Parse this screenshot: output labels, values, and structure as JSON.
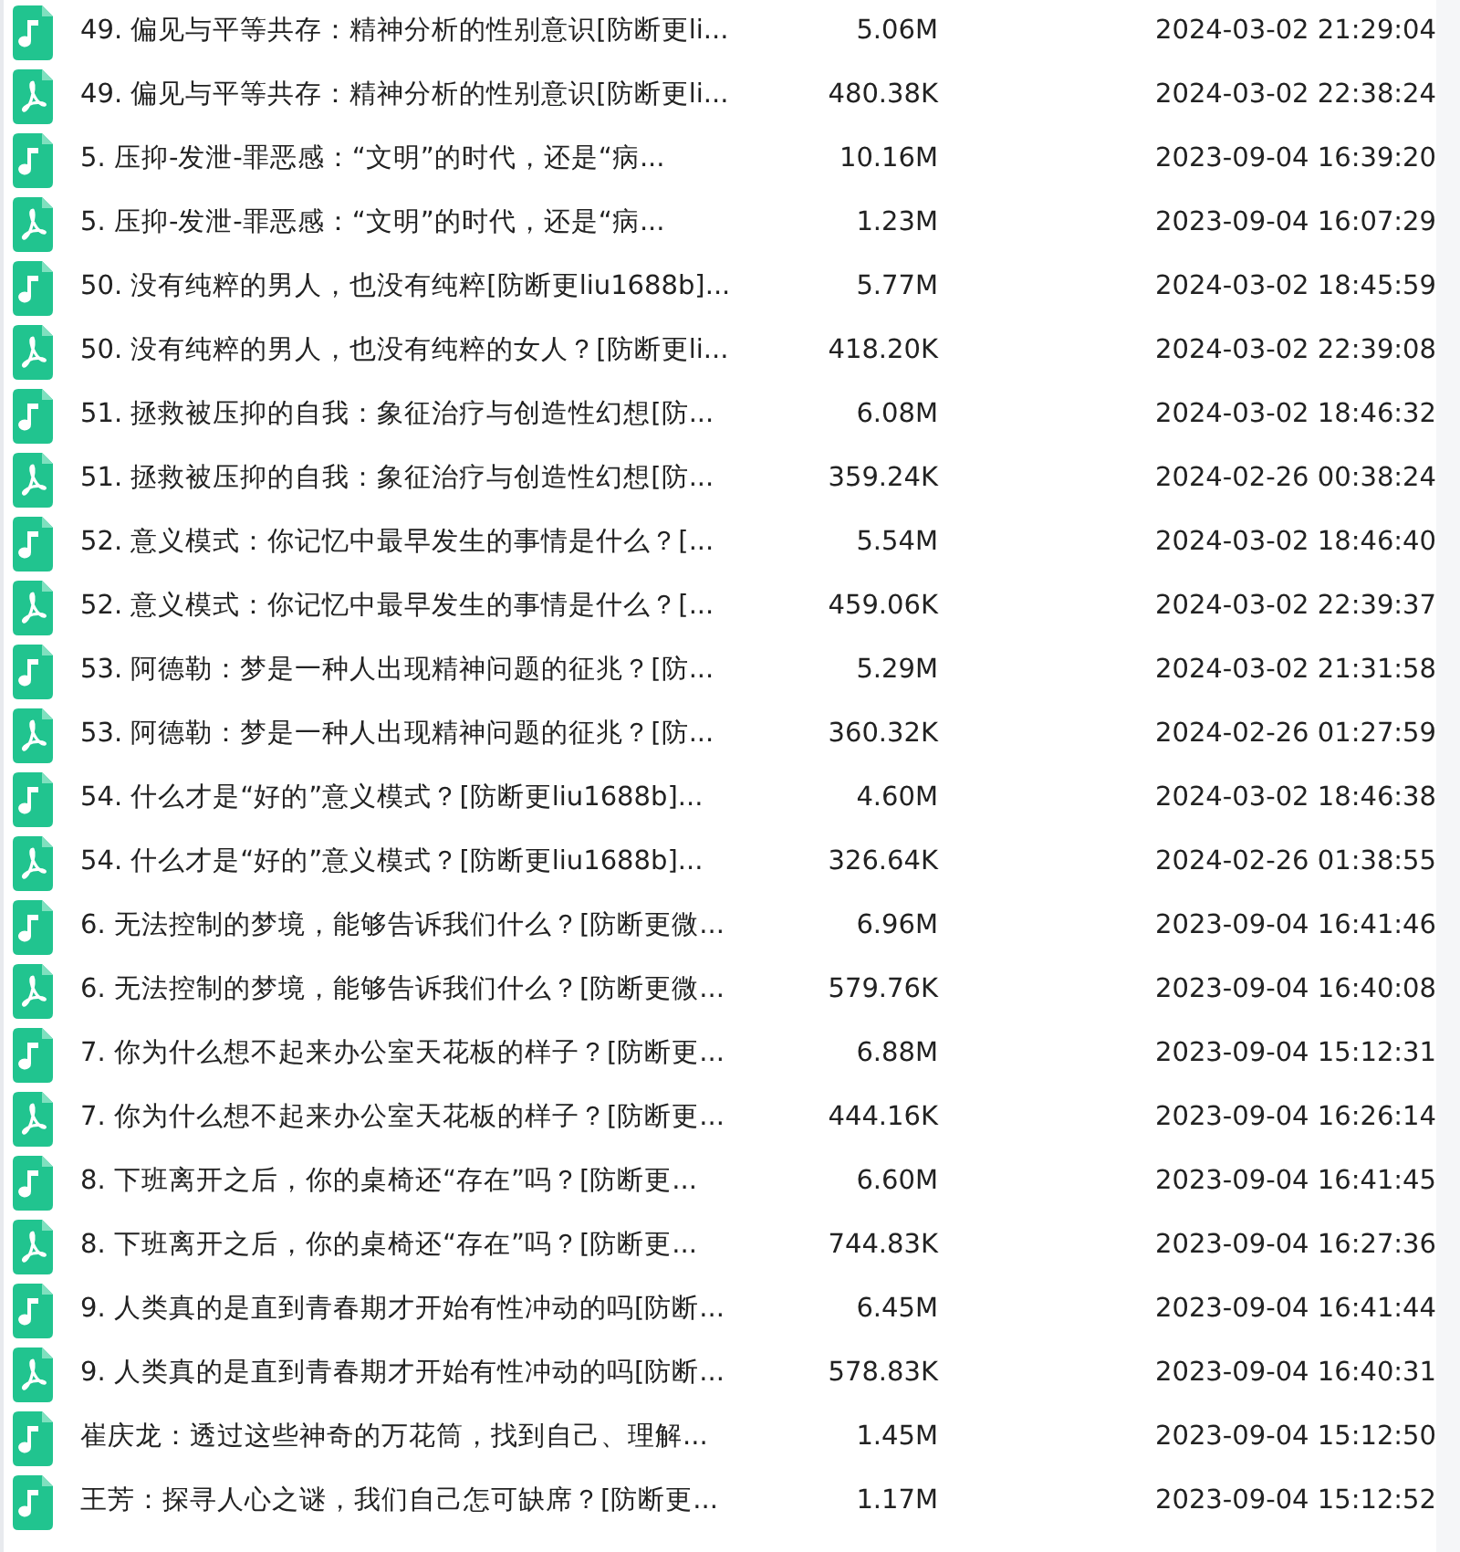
{
  "files": [
    {
      "kind": "audio",
      "name": "49. 偏见与平等共存：精神分析的性别意识[防断更li...",
      "size": "5.06M",
      "modified": "2024-03-02 21:29:04"
    },
    {
      "kind": "pdf",
      "name": "49. 偏见与平等共存：精神分析的性别意识[防断更li...",
      "size": "480.38K",
      "modified": "2024-03-02 22:38:24"
    },
    {
      "kind": "audio",
      "name": "5. 压抑-发泄-罪恶感：“文明”的时代，还是“病...",
      "size": "10.16M",
      "modified": "2023-09-04 16:39:20"
    },
    {
      "kind": "pdf",
      "name": "5. 压抑-发泄-罪恶感：“文明”的时代，还是“病...",
      "size": "1.23M",
      "modified": "2023-09-04 16:07:29"
    },
    {
      "kind": "audio",
      "name": "50. 没有纯粹的男人，也没有纯粹[防断更liu1688b]...",
      "size": "5.77M",
      "modified": "2024-03-02 18:45:59"
    },
    {
      "kind": "pdf",
      "name": "50. 没有纯粹的男人，也没有纯粹的女人？[防断更li...",
      "size": "418.20K",
      "modified": "2024-03-02 22:39:08"
    },
    {
      "kind": "audio",
      "name": "51. 拯救被压抑的自我：象征治疗与创造性幻想[防...",
      "size": "6.08M",
      "modified": "2024-03-02 18:46:32"
    },
    {
      "kind": "pdf",
      "name": "51. 拯救被压抑的自我：象征治疗与创造性幻想[防...",
      "size": "359.24K",
      "modified": "2024-02-26 00:38:24"
    },
    {
      "kind": "audio",
      "name": "52. 意义模式：你记忆中最早发生的事情是什么？[...",
      "size": "5.54M",
      "modified": "2024-03-02 18:46:40"
    },
    {
      "kind": "pdf",
      "name": "52. 意义模式：你记忆中最早发生的事情是什么？[...",
      "size": "459.06K",
      "modified": "2024-03-02 22:39:37"
    },
    {
      "kind": "audio",
      "name": "53. 阿德勒：梦是一种人出现精神问题的征兆？[防...",
      "size": "5.29M",
      "modified": "2024-03-02 21:31:58"
    },
    {
      "kind": "pdf",
      "name": "53. 阿德勒：梦是一种人出现精神问题的征兆？[防...",
      "size": "360.32K",
      "modified": "2024-02-26 01:27:59"
    },
    {
      "kind": "audio",
      "name": "54. 什么才是“好的”意义模式？[防断更liu1688b]...",
      "size": "4.60M",
      "modified": "2024-03-02 18:46:38"
    },
    {
      "kind": "pdf",
      "name": "54. 什么才是“好的”意义模式？[防断更liu1688b]...",
      "size": "326.64K",
      "modified": "2024-02-26 01:38:55"
    },
    {
      "kind": "audio",
      "name": "6. 无法控制的梦境，能够告诉我们什么？[防断更微...",
      "size": "6.96M",
      "modified": "2023-09-04 16:41:46"
    },
    {
      "kind": "pdf",
      "name": "6. 无法控制的梦境，能够告诉我们什么？[防断更微...",
      "size": "579.76K",
      "modified": "2023-09-04 16:40:08"
    },
    {
      "kind": "audio",
      "name": "7. 你为什么想不起来办公室天花板的样子？[防断更...",
      "size": "6.88M",
      "modified": "2023-09-04 15:12:31"
    },
    {
      "kind": "pdf",
      "name": "7. 你为什么想不起来办公室天花板的样子？[防断更...",
      "size": "444.16K",
      "modified": "2023-09-04 16:26:14"
    },
    {
      "kind": "audio",
      "name": "8. 下班离开之后，你的桌椅还“存在”吗？[防断更...",
      "size": "6.60M",
      "modified": "2023-09-04 16:41:45"
    },
    {
      "kind": "pdf",
      "name": "8. 下班离开之后，你的桌椅还“存在”吗？[防断更...",
      "size": "744.83K",
      "modified": "2023-09-04 16:27:36"
    },
    {
      "kind": "audio",
      "name": "9. 人类真的是直到青春期才开始有性冲动的吗[防断...",
      "size": "6.45M",
      "modified": "2023-09-04 16:41:44"
    },
    {
      "kind": "pdf",
      "name": "9. 人类真的是直到青春期才开始有性冲动的吗[防断...",
      "size": "578.83K",
      "modified": "2023-09-04 16:40:31"
    },
    {
      "kind": "audio",
      "name": "崔庆龙：透过这些神奇的万花筒，找到自己、理解...",
      "size": "1.45M",
      "modified": "2023-09-04 15:12:50"
    },
    {
      "kind": "audio",
      "name": "王芳：探寻人心之谜，我们自己怎可缺席？[防断更...",
      "size": "1.17M",
      "modified": "2023-09-04 15:12:52"
    }
  ]
}
